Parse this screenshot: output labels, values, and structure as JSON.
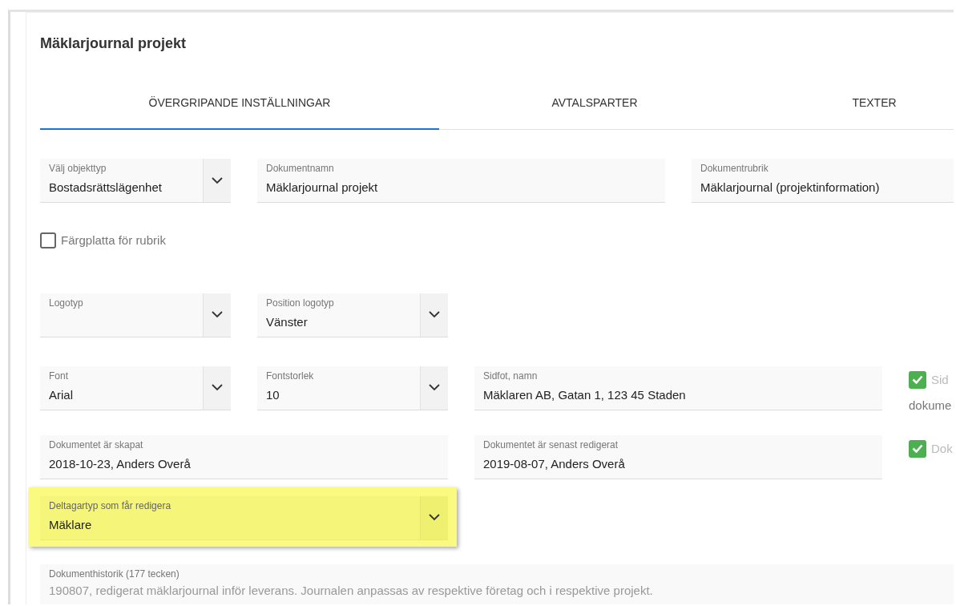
{
  "title": "Mäklarjournal projekt",
  "tabs": [
    {
      "label": "ÖVERGRIPANDE INSTÄLLNINGAR",
      "selected": true
    },
    {
      "label": "AVTALSPARTER",
      "selected": false
    },
    {
      "label": "TEXTER",
      "selected": false
    }
  ],
  "rows": [
    {
      "items": [
        {
          "kind": "select",
          "label": "Välj objekttyp",
          "value": "Bostadsrättslägenhet"
        },
        {
          "kind": "text",
          "label": "Dokumentnamn",
          "value": "Mäklarjournal projekt"
        },
        {
          "kind": "text",
          "label": "Dokumentrubrik",
          "value": "Mäklarjournal (projektinformation)"
        }
      ]
    },
    {
      "items": [
        {
          "kind": "checkbox",
          "label_lines": [
            "Färgplatta för rubrik"
          ],
          "checked": false
        }
      ]
    },
    {
      "items": [
        {
          "kind": "select",
          "label": "Logotyp"
        },
        {
          "kind": "select",
          "label": "Position logotyp",
          "value": "Vänster"
        }
      ]
    },
    {
      "items": [
        {
          "kind": "select",
          "label": "Font",
          "value": "Arial"
        },
        {
          "kind": "select",
          "label": "Fontstorlek",
          "value": "10"
        },
        {
          "kind": "text",
          "label": "Sidfot, namn",
          "value": "Mäklaren AB, Gatan 1, 123 45 Staden"
        },
        {
          "kind": "checkbox",
          "label_lines": [
            "Sid",
            "dokume"
          ],
          "checked": true
        }
      ]
    },
    {
      "items": [
        {
          "kind": "text",
          "label": "Dokumentet är skapat",
          "value": "2018-10-23, Anders Overå"
        },
        {
          "kind": "text",
          "label": "Dokumentet är senast redigerat",
          "value": "2019-08-07, Anders Overå"
        },
        {
          "kind": "checkbox",
          "label_lines": [
            "Dok"
          ],
          "checked": true
        }
      ]
    },
    {
      "highlighted": true,
      "items": [
        {
          "kind": "select",
          "label": "Deltagartyp som får redigera",
          "value": "Mäklare"
        }
      ]
    },
    {
      "items": [
        {
          "kind": "textarea",
          "disabled": true,
          "label": "Dokumenthistorik (177 tecken)",
          "value": "190807, redigerat mäklarjournal inför leverans. Journalen anpassas av respektive företag och i respektive projekt."
        }
      ]
    }
  ]
}
